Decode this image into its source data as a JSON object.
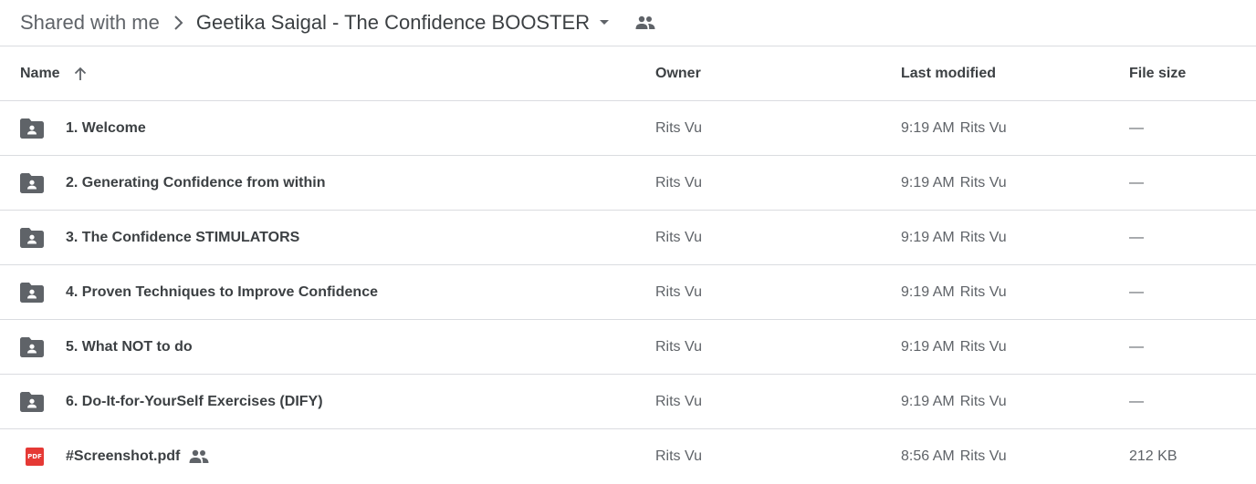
{
  "breadcrumb": {
    "parent": "Shared with me",
    "current": "Geetika Saigal - The Confidence BOOSTER"
  },
  "columns": {
    "name": "Name",
    "owner": "Owner",
    "last_modified": "Last modified",
    "file_size": "File size"
  },
  "rows": [
    {
      "type": "shared-folder",
      "name": "1. Welcome",
      "owner": "Rits Vu",
      "time": "9:19 AM",
      "modified_by": "Rits Vu",
      "size": "—"
    },
    {
      "type": "shared-folder",
      "name": "2. Generating Confidence from within",
      "owner": "Rits Vu",
      "time": "9:19 AM",
      "modified_by": "Rits Vu",
      "size": "—"
    },
    {
      "type": "shared-folder",
      "name": "3. The Confidence STIMULATORS",
      "owner": "Rits Vu",
      "time": "9:19 AM",
      "modified_by": "Rits Vu",
      "size": "—"
    },
    {
      "type": "shared-folder",
      "name": "4. Proven Techniques to Improve Confidence",
      "owner": "Rits Vu",
      "time": "9:19 AM",
      "modified_by": "Rits Vu",
      "size": "—"
    },
    {
      "type": "shared-folder",
      "name": "5. What NOT to do",
      "owner": "Rits Vu",
      "time": "9:19 AM",
      "modified_by": "Rits Vu",
      "size": "—"
    },
    {
      "type": "shared-folder",
      "name": "6. Do-It-for-YourSelf Exercises (DIFY)",
      "owner": "Rits Vu",
      "time": "9:19 AM",
      "modified_by": "Rits Vu",
      "size": "—"
    },
    {
      "type": "pdf",
      "name": "#Screenshot.pdf",
      "owner": "Rits Vu",
      "time": "8:56 AM",
      "modified_by": "Rits Vu",
      "size": "212 KB",
      "icon_label": "PDF"
    }
  ],
  "colors": {
    "folder": "#5f6368",
    "pdf": "#e53935",
    "divider": "#dadce0"
  }
}
